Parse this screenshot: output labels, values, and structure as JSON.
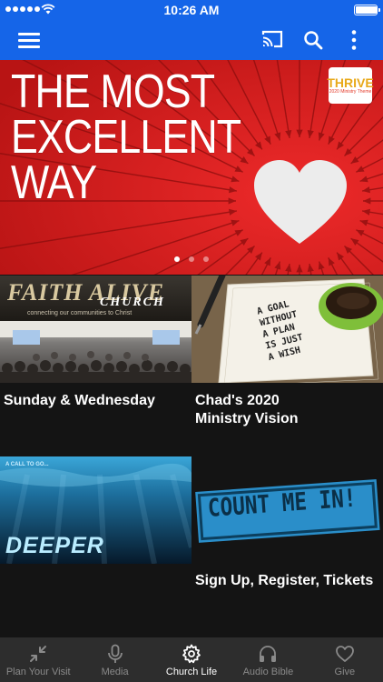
{
  "status_bar": {
    "time": "10:26 AM",
    "battery_level": 0.95
  },
  "app_bar": {
    "icons": [
      "menu-icon",
      "cast-icon",
      "search-icon",
      "more-vertical-icon"
    ]
  },
  "hero": {
    "title": "THE MOST\nEXCELLENT\nWAY",
    "logo_text": "THRIVE",
    "logo_subtext": "2020 Ministry Theme",
    "slide_count": 3,
    "active_slide": 1,
    "colors": {
      "background": "#d42020",
      "heart": "#ececec"
    }
  },
  "tiles": [
    {
      "caption": "Sunday & Wednesday",
      "image_title": "FAITH ALIVE",
      "image_subtitle": "CHURCH",
      "image_tagline": "connecting our communities to Christ"
    },
    {
      "caption": "Chad's 2020\nMinistry Vision",
      "image_text": "A GOAL\nWITHOUT\nA PLAN\nIS JUST\nA WISH"
    },
    {
      "caption": "",
      "image_kicker": "A CALL TO GO...",
      "image_title": "DEEPER"
    },
    {
      "caption": "Sign Up, Register, Tickets",
      "image_text": "COUNT ME IN!"
    }
  ],
  "bottom_nav": {
    "items": [
      {
        "label": "Plan Your Visit",
        "icon": "compress-arrows-icon"
      },
      {
        "label": "Media",
        "icon": "microphone-icon"
      },
      {
        "label": "Church Life",
        "icon": "gear-icon"
      },
      {
        "label": "Audio Bible",
        "icon": "headphones-icon"
      },
      {
        "label": "Give",
        "icon": "heart-icon"
      }
    ],
    "active_index": 2
  },
  "colors": {
    "brand": "#1565e8",
    "nav_background": "#2d2d2d",
    "page_background": "#141414"
  }
}
